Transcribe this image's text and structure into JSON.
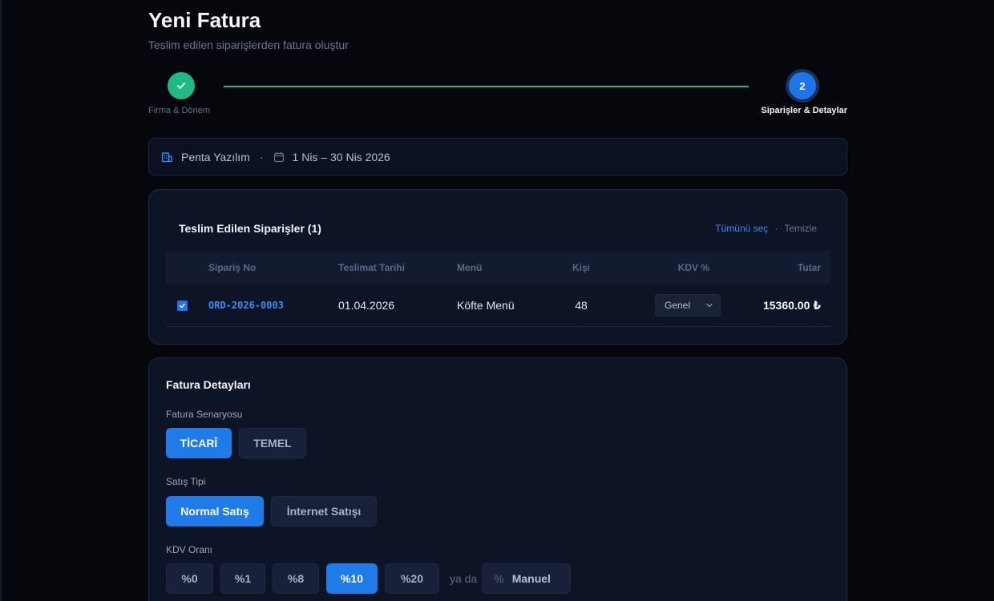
{
  "page": {
    "title": "Yeni Fatura",
    "subtitle": "Teslim edilen siparişlerden fatura oluştur"
  },
  "stepper": {
    "steps": [
      {
        "label": "Firma & Dönem",
        "state": "done"
      },
      {
        "number": "2",
        "label": "Siparişler & Detaylar",
        "state": "active"
      }
    ]
  },
  "info": {
    "company": "Penta Yazılım",
    "separator": "·",
    "period": "1 Nis – 30 Nis 2026"
  },
  "orders": {
    "title": "Teslim Edilen Siparişler (1)",
    "select_all": "Tümünü seç",
    "separator": "·",
    "clear": "Temizle",
    "columns": [
      "Sipariş No",
      "Teslimat Tarihi",
      "Menü",
      "Kişi",
      "KDV %",
      "Tutar"
    ],
    "rows": [
      {
        "checked": true,
        "order_no": "ORD-2026-0003",
        "date": "01.04.2026",
        "menu": "Köfte Menü",
        "people": "48",
        "vat": "Genel",
        "amount": "15360.00 ₺"
      }
    ]
  },
  "details": {
    "title": "Fatura Detayları",
    "scenario": {
      "label": "Fatura Senaryosu",
      "options": [
        "TİCARÎ",
        "TEMEL"
      ],
      "selected": 0
    },
    "sale_type": {
      "label": "Satış Tipi",
      "options": [
        "Normal Satış",
        "İnternet Satışı"
      ],
      "selected": 0
    },
    "vat_rate": {
      "label": "KDV Oranı",
      "options": [
        "%0",
        "%1",
        "%8",
        "%10",
        "%20"
      ],
      "selected": 3,
      "or_text": "ya da",
      "percent_symbol": "%",
      "manual_placeholder": "Manuel"
    }
  },
  "colors": {
    "accent": "#1f7be8",
    "success": "#1fb985",
    "link": "#3a8cf0"
  }
}
